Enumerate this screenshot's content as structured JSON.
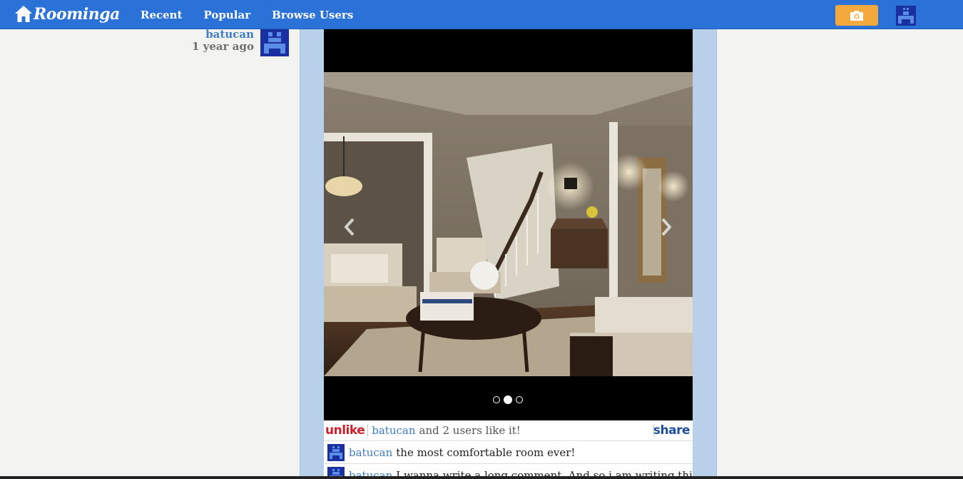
{
  "header": {
    "logo_text": "Roominga",
    "nav": [
      {
        "label": "Recent"
      },
      {
        "label": "Popular"
      },
      {
        "label": "Browse Users"
      }
    ],
    "camera_icon": "camera-icon",
    "brand_color": "#2a72d8",
    "camera_color": "#f4a93d"
  },
  "author": {
    "name": "batucan",
    "time": "1 year ago"
  },
  "gallery": {
    "slide_count": 3,
    "active_slide": 2,
    "prev_icon": "chevron-left-icon",
    "next_icon": "chevron-right-icon"
  },
  "likes": {
    "action": "unlike",
    "user": "batucan",
    "rest": "and 2 users like it!",
    "share": "share"
  },
  "comments": [
    {
      "user": "batucan",
      "text": "the most comfortable room ever!"
    },
    {
      "user": "batucan",
      "text": "I wanna write a long comment. And so i am writing this"
    }
  ]
}
